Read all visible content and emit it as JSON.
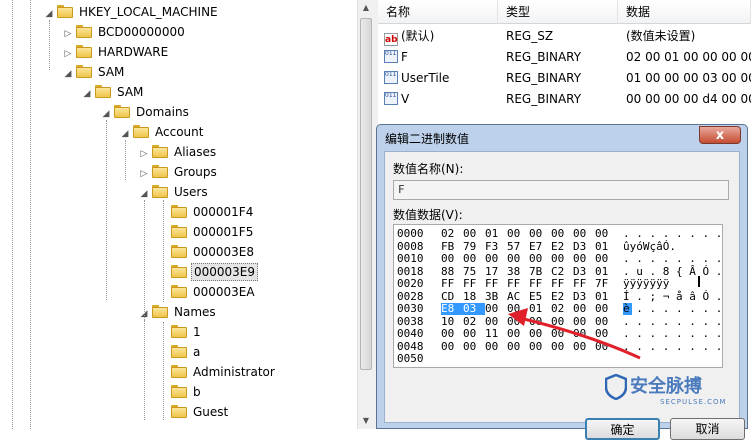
{
  "tree": {
    "nodes": [
      {
        "label": "HKEY_LOCAL_MACHINE",
        "exp": "◢"
      },
      {
        "label": "BCD00000000",
        "exp": "▷"
      },
      {
        "label": "HARDWARE",
        "exp": "▷"
      },
      {
        "label": "SAM",
        "exp": "◢"
      },
      {
        "label": "SAM",
        "exp": "◢"
      },
      {
        "label": "Domains",
        "exp": "◢"
      },
      {
        "label": "Account",
        "exp": "◢"
      },
      {
        "label": "Aliases",
        "exp": "▷"
      },
      {
        "label": "Groups",
        "exp": "▷"
      },
      {
        "label": "Users",
        "exp": "◢"
      },
      {
        "label": "000001F4",
        "exp": ""
      },
      {
        "label": "000001F5",
        "exp": ""
      },
      {
        "label": "000003E8",
        "exp": ""
      },
      {
        "label": "000003E9",
        "exp": ""
      },
      {
        "label": "000003EA",
        "exp": ""
      },
      {
        "label": "Names",
        "exp": "◢"
      },
      {
        "label": "1",
        "exp": ""
      },
      {
        "label": "a",
        "exp": ""
      },
      {
        "label": "Administrator",
        "exp": ""
      },
      {
        "label": "b",
        "exp": ""
      },
      {
        "label": "Guest",
        "exp": ""
      }
    ]
  },
  "list": {
    "headers": {
      "name": "名称",
      "type": "类型",
      "data": "数据"
    },
    "rows": [
      {
        "name": "(默认)",
        "type": "REG_SZ",
        "data": "(数值未设置)",
        "icon": "string-value-icon"
      },
      {
        "name": "F",
        "type": "REG_BINARY",
        "data": "02 00 01 00 00 00 00",
        "icon": "binary-value-icon"
      },
      {
        "name": "UserTile",
        "type": "REG_BINARY",
        "data": "01 00 00 00 03 00 00",
        "icon": "binary-value-icon"
      },
      {
        "name": "V",
        "type": "REG_BINARY",
        "data": "00 00 00 00 d4 00 00",
        "icon": "binary-value-icon"
      }
    ]
  },
  "dialog": {
    "title": "编辑二进制数值",
    "close": "x",
    "name_label": "数值名称(N):",
    "name_value": "F",
    "data_label": "数值数据(V):",
    "ok": "确定",
    "cancel": "取消",
    "hex_rows": [
      {
        "off": "0000",
        "bytes": [
          "02",
          "00",
          "01",
          "00",
          "00",
          "00",
          "00",
          "00"
        ],
        "ascii": ". . . . . . . ."
      },
      {
        "off": "0008",
        "bytes": [
          "FB",
          "79",
          "F3",
          "57",
          "E7",
          "E2",
          "D3",
          "01"
        ],
        "ascii": "ûyóWçâÓ."
      },
      {
        "off": "0010",
        "bytes": [
          "00",
          "00",
          "00",
          "00",
          "00",
          "00",
          "00",
          "00"
        ],
        "ascii": ". . . . . . . ."
      },
      {
        "off": "0018",
        "bytes": [
          "88",
          "75",
          "17",
          "38",
          "7B",
          "C2",
          "D3",
          "01"
        ],
        "ascii": ". u . 8 { Â Ó ."
      },
      {
        "off": "0020",
        "bytes": [
          "FF",
          "FF",
          "FF",
          "FF",
          "FF",
          "FF",
          "FF",
          "7F"
        ],
        "ascii": "ÿÿÿÿÿÿÿ"
      },
      {
        "off": "0028",
        "bytes": [
          "CD",
          "18",
          "3B",
          "AC",
          "E5",
          "E2",
          "D3",
          "01"
        ],
        "ascii": "Í . ; ¬ å â Ó ."
      },
      {
        "off": "0030",
        "bytes": [
          "E8",
          "03",
          "00",
          "00",
          "01",
          "02",
          "00",
          "00"
        ],
        "ascii": "è . . . . . . ."
      },
      {
        "off": "0038",
        "bytes": [
          "10",
          "02",
          "00",
          "00",
          "00",
          "00",
          "00",
          "00"
        ],
        "ascii": ". . . . . . . ."
      },
      {
        "off": "0040",
        "bytes": [
          "00",
          "00",
          "11",
          "00",
          "00",
          "00",
          "00",
          "00"
        ],
        "ascii": ". . . . . . . ."
      },
      {
        "off": "0048",
        "bytes": [
          "00",
          "00",
          "00",
          "00",
          "00",
          "00",
          "00",
          "00"
        ],
        "ascii": ". . . . . . . ."
      },
      {
        "off": "0050",
        "bytes": [],
        "ascii": ""
      }
    ],
    "selected_bytes": [
      "E8",
      "03"
    ]
  },
  "watermark": {
    "text": "安全脉搏",
    "sub": "SECPULSE.COM"
  },
  "colors": {
    "selection": "#3399ff",
    "annotation_arrow": "#e0202a",
    "dialog_frame": "#bdd1ea",
    "close_button": "#c44b32"
  }
}
